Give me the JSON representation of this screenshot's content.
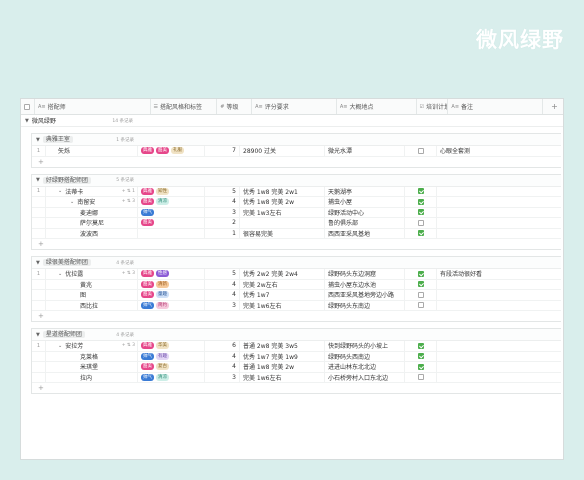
{
  "brand": "微风绿野",
  "columns": {
    "name": "搭配师",
    "tags": "搭配风格和标签",
    "level": "等级",
    "req": "评分要求",
    "loc": "大概地点",
    "plan": "培训计划",
    "note": "备注",
    "add": "+"
  },
  "top_group": {
    "label": "微风绿野",
    "count": "14 条记录"
  },
  "groups": [
    {
      "name": "典雅王室",
      "count": "1 条记录",
      "rows": [
        {
          "num": "1",
          "name": "矢烁",
          "tags": [
            {
              "t": "典雅",
              "c": "pink"
            },
            {
              "t": "甜美",
              "c": "pink"
            },
            {
              "t": "礼服",
              "c": "tan"
            }
          ],
          "level": "7",
          "req": "28900 过关",
          "loc": "微光水潭",
          "plan": false,
          "note": "心眼全套测"
        }
      ]
    },
    {
      "name": "好绿野搭配师团",
      "count": "5 条记录",
      "rows": [
        {
          "num": "1",
          "name": "法蒂卡",
          "ctl": "+ ⇅ 1",
          "tags": [
            {
              "t": "典雅",
              "c": "pink"
            },
            {
              "t": "知性",
              "c": "tan"
            }
          ],
          "level": "5",
          "req": "优秀 1w8 完美 2w1",
          "loc": "天鹅湖亭",
          "plan": true,
          "note": ""
        },
        {
          "num": "",
          "name": "南留安",
          "ctl": "+ ⇅ 3",
          "tags": [
            {
              "t": "甜美",
              "c": "pink"
            },
            {
              "t": "清凉",
              "c": "teal"
            }
          ],
          "level": "4",
          "req": "优秀 1w8 完美 2w",
          "loc": "捕虫小屋",
          "plan": true,
          "note": ""
        },
        {
          "num": "",
          "name": "麦迪娜",
          "tags": [
            {
              "t": "帅气",
              "c": "blue"
            }
          ],
          "level": "3",
          "req": "完美 1w3左右",
          "loc": "绿野活动中心",
          "plan": true,
          "note": ""
        },
        {
          "num": "",
          "name": "萨尔莫尼",
          "tags": [
            {
              "t": "甜美",
              "c": "pink"
            }
          ],
          "level": "2",
          "req": "",
          "loc": "鲁的俱乐部",
          "plan": false,
          "note": ""
        },
        {
          "num": "",
          "name": "波波西",
          "tags": [],
          "level": "1",
          "req": "很容易完美",
          "loc": "西西亚采风基地",
          "plan": true,
          "note": ""
        }
      ]
    },
    {
      "name": "绿很美搭配师团",
      "count": "4 条记录",
      "rows": [
        {
          "num": "1",
          "name": "优拉露",
          "ctl": "+ ⇅ 3",
          "tags": [
            {
              "t": "典雅",
              "c": "pink"
            },
            {
              "t": "性感",
              "c": "purple"
            }
          ],
          "level": "5",
          "req": "优秀 2w2 完美 2w4",
          "loc": "绿野码头东边洞窟",
          "plan": true,
          "note": "有段活动很好看"
        },
        {
          "num": "",
          "name": "黄兆",
          "tags": [
            {
              "t": "甜美",
              "c": "pink"
            },
            {
              "t": "清新",
              "c": "orange"
            }
          ],
          "level": "4",
          "req": "完美 2w左右",
          "loc": "捕虫小屋东边水池",
          "plan": true,
          "note": ""
        },
        {
          "num": "",
          "name": "图",
          "tags": [
            {
              "t": "甜美",
              "c": "pink"
            },
            {
              "t": "童趣",
              "c": "lblue"
            }
          ],
          "level": "4",
          "req": "优秀 1w7",
          "loc": "西西亚采风基地旁边小路",
          "plan": false,
          "note": ""
        },
        {
          "num": "",
          "name": "西比拉",
          "tags": [
            {
              "t": "帅气",
              "c": "blue"
            },
            {
              "t": "简约",
              "c": "lpink"
            }
          ],
          "level": "3",
          "req": "完美 1w6左右",
          "loc": "绿野码头东南边",
          "plan": false,
          "note": ""
        }
      ]
    },
    {
      "name": "星道搭配师团",
      "count": "4 条记录",
      "rows": [
        {
          "num": "1",
          "name": "安拉芳",
          "ctl": "+ ⇅ 3",
          "tags": [
            {
              "t": "典雅",
              "c": "pink"
            },
            {
              "t": "华美",
              "c": "tan"
            }
          ],
          "level": "6",
          "req": "普通 2w8 完美 3w5",
          "loc": "快到绿野码头的小坡上",
          "plan": true,
          "note": ""
        },
        {
          "num": "",
          "name": "克莱格",
          "tags": [
            {
              "t": "帅气",
              "c": "blue"
            },
            {
              "t": "有趣",
              "c": "lpurple"
            }
          ],
          "level": "4",
          "req": "优秀 1w7 完美 1w9",
          "loc": "绿野码头西南边",
          "plan": true,
          "note": ""
        },
        {
          "num": "",
          "name": "米琪堡",
          "tags": [
            {
              "t": "甜美",
              "c": "pink"
            },
            {
              "t": "复古",
              "c": "tan"
            }
          ],
          "level": "4",
          "req": "普通 1w8 完美 2w",
          "loc": "进进山林东北北边",
          "plan": true,
          "note": ""
        },
        {
          "num": "",
          "name": "拉内",
          "tags": [
            {
              "t": "帅气",
              "c": "blue"
            },
            {
              "t": "清凉",
              "c": "teal"
            }
          ],
          "level": "3",
          "req": "完美 1w6左右",
          "loc": "小石桥旁村入口东北边",
          "plan": false,
          "note": ""
        }
      ]
    }
  ]
}
